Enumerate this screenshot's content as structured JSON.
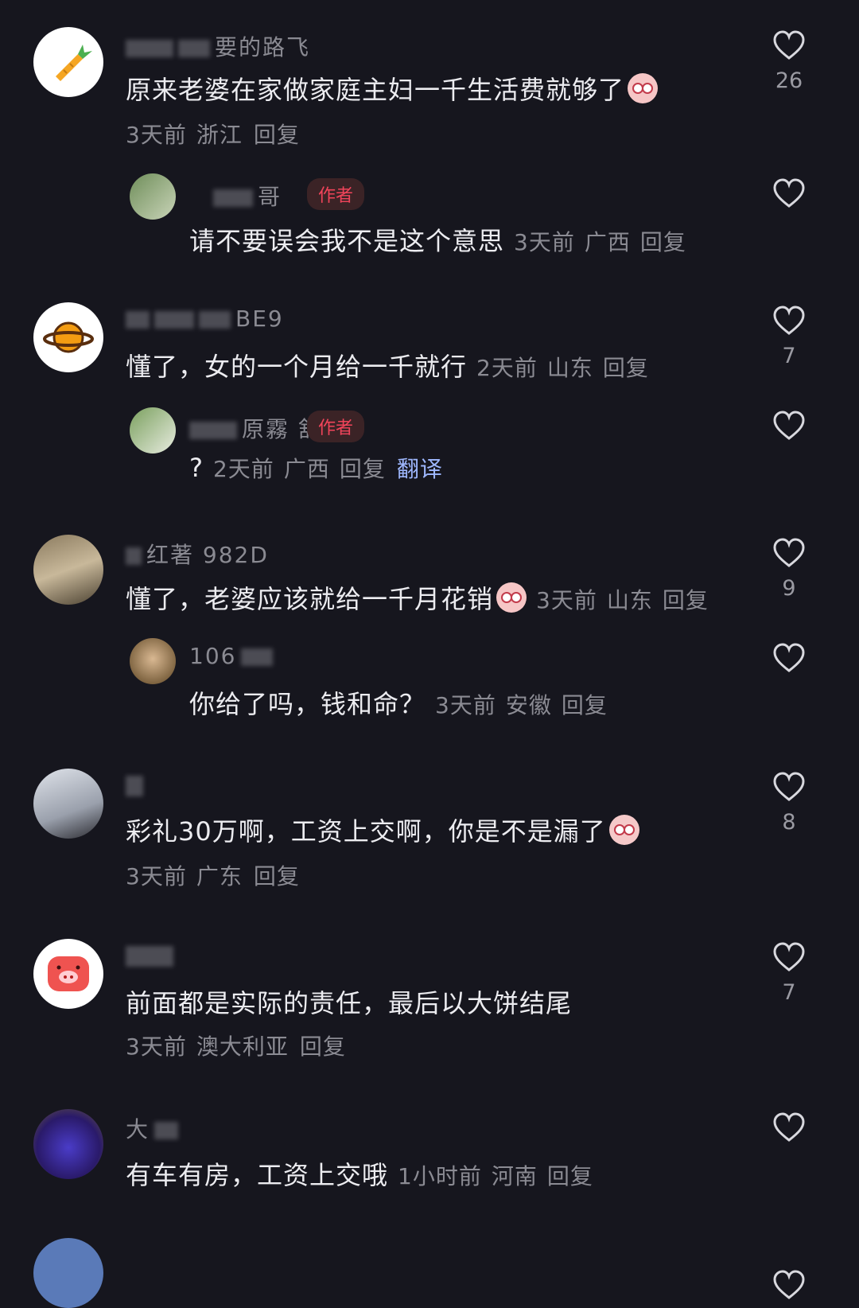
{
  "comments": [
    {
      "text": "原来老婆在家做家庭主妇一千生活费就够了",
      "meta_time": "3天前",
      "meta_loc": "浙江",
      "reply_label": "回复",
      "likes": "26",
      "username_partial": "要的路飞",
      "emoji": "pig-embarrassed-emoji",
      "avatar_icon": "carrot-icon",
      "reply": {
        "username_partial": "哥",
        "badge": "作者",
        "text": "请不要误会我不是这个意思",
        "meta_time": "3天前",
        "meta_loc": "广西",
        "reply_label": "回复"
      }
    },
    {
      "text": "懂了，女的一个月给一千就行",
      "meta_time": "2天前",
      "meta_loc": "山东",
      "reply_label": "回复",
      "likes": "7",
      "username_partial": "BE9",
      "avatar_icon": "planet-icon",
      "reply": {
        "username_partial": "原霧 舒",
        "badge": "作者",
        "text": "?",
        "meta_time": "2天前",
        "meta_loc": "广西",
        "reply_label": "回复",
        "translate_label": "翻译"
      }
    },
    {
      "text": "懂了，老婆应该就给一千月花销",
      "meta_time": "3天前",
      "meta_loc": "山东",
      "reply_label": "回复",
      "likes": "9",
      "username_partial": "红著 982D",
      "emoji": "pig-embarrassed-emoji",
      "avatar_icon": "photo-avatar",
      "reply": {
        "username_partial": "106",
        "text": "你给了吗，钱和命？",
        "meta_time": "3天前",
        "meta_loc": "安徽",
        "reply_label": "回复"
      }
    },
    {
      "text": "彩礼30万啊，工资上交啊，你是不是漏了",
      "meta_time": "3天前",
      "meta_loc": "广东",
      "reply_label": "回复",
      "likes": "8",
      "emoji": "pig-sweat-emoji",
      "avatar_icon": "photo-avatar"
    },
    {
      "text": "前面都是实际的责任，最后以大饼结尾",
      "meta_time": "3天前",
      "meta_loc": "澳大利亚",
      "reply_label": "回复",
      "likes": "7",
      "avatar_icon": "pig-avatar"
    },
    {
      "text": "有车有房，工资上交哦",
      "meta_time": "1小时前",
      "meta_loc": "河南",
      "reply_label": "回复",
      "username_partial": "大",
      "avatar_icon": "photo-avatar"
    }
  ],
  "colors": {
    "background": "#16161e",
    "text": "#ececf0",
    "meta": "#8b8b93",
    "author_badge": "#f0445a",
    "translate": "#9fb8ff"
  }
}
